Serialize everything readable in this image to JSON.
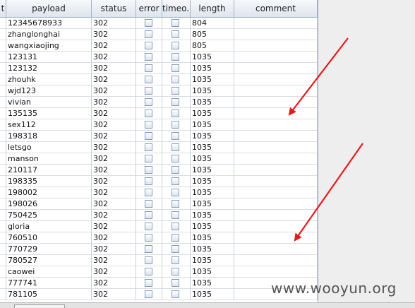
{
  "table": {
    "columns": [
      "t",
      "payload",
      "status",
      "error",
      "timeo...",
      "length",
      "comment"
    ],
    "rows": [
      {
        "payload": "12345678933",
        "status": "302",
        "length": "804",
        "error": false,
        "timeout": false
      },
      {
        "payload": "zhanglonghai",
        "status": "302",
        "length": "805",
        "error": false,
        "timeout": false
      },
      {
        "payload": "wangxiaojing",
        "status": "302",
        "length": "805",
        "error": false,
        "timeout": false
      },
      {
        "payload": "123131",
        "status": "302",
        "length": "1035",
        "error": false,
        "timeout": false
      },
      {
        "payload": "123132",
        "status": "302",
        "length": "1035",
        "error": false,
        "timeout": false
      },
      {
        "payload": "zhouhk",
        "status": "302",
        "length": "1035",
        "error": false,
        "timeout": false
      },
      {
        "payload": "wjd123",
        "status": "302",
        "length": "1035",
        "error": false,
        "timeout": false
      },
      {
        "payload": "vivian",
        "status": "302",
        "length": "1035",
        "error": false,
        "timeout": false
      },
      {
        "payload": "135135",
        "status": "302",
        "length": "1035",
        "error": false,
        "timeout": false
      },
      {
        "payload": "sex112",
        "status": "302",
        "length": "1035",
        "error": false,
        "timeout": false
      },
      {
        "payload": "198318",
        "status": "302",
        "length": "1035",
        "error": false,
        "timeout": false
      },
      {
        "payload": "letsgo",
        "status": "302",
        "length": "1035",
        "error": false,
        "timeout": false
      },
      {
        "payload": "manson",
        "status": "302",
        "length": "1035",
        "error": false,
        "timeout": false
      },
      {
        "payload": "210117",
        "status": "302",
        "length": "1035",
        "error": false,
        "timeout": false
      },
      {
        "payload": "198335",
        "status": "302",
        "length": "1035",
        "error": false,
        "timeout": false
      },
      {
        "payload": "198002",
        "status": "302",
        "length": "1035",
        "error": false,
        "timeout": false
      },
      {
        "payload": "198026",
        "status": "302",
        "length": "1035",
        "error": false,
        "timeout": false
      },
      {
        "payload": "750425",
        "status": "302",
        "length": "1035",
        "error": false,
        "timeout": false
      },
      {
        "payload": "gloria",
        "status": "302",
        "length": "1035",
        "error": false,
        "timeout": false
      },
      {
        "payload": "760510",
        "status": "302",
        "length": "1035",
        "error": false,
        "timeout": false
      },
      {
        "payload": "770729",
        "status": "302",
        "length": "1035",
        "error": false,
        "timeout": false
      },
      {
        "payload": "780527",
        "status": "302",
        "length": "1035",
        "error": false,
        "timeout": false
      },
      {
        "payload": "caowei",
        "status": "302",
        "length": "1035",
        "error": false,
        "timeout": false
      },
      {
        "payload": "777741",
        "status": "302",
        "length": "1035",
        "error": false,
        "timeout": false
      },
      {
        "payload": "781105",
        "status": "302",
        "length": "1035",
        "error": false,
        "timeout": false
      }
    ]
  },
  "watermark": "www.wooyun.org",
  "colors": {
    "arrow": "#e8191c",
    "header_bg": "#dfe5ee",
    "grid": "#c8d0da"
  }
}
